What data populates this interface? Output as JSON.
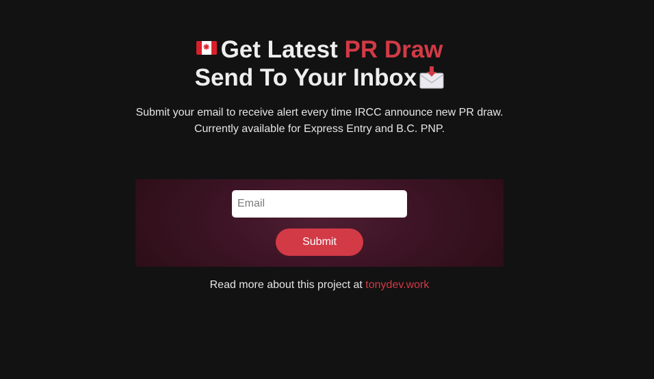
{
  "hero": {
    "title_line1_prefix": "Get Latest ",
    "title_line1_accent": "PR Draw",
    "title_line2": "Send To Your Inbox",
    "flag_icon": "canada-flag-icon",
    "envelope_icon": "incoming-envelope-icon",
    "description_line1": "Submit your email to receive alert every time IRCC announce new PR draw.",
    "description_line2": "Currently available for Express Entry and B.C. PNP."
  },
  "form": {
    "email_placeholder": "Email",
    "email_value": "",
    "submit_label": "Submit"
  },
  "footer": {
    "text": "Read more about this project at ",
    "link_text": "tonydev.work"
  },
  "colors": {
    "background": "#121212",
    "accent": "#d23a46",
    "panel": "#3d1425",
    "text": "#ececec"
  }
}
